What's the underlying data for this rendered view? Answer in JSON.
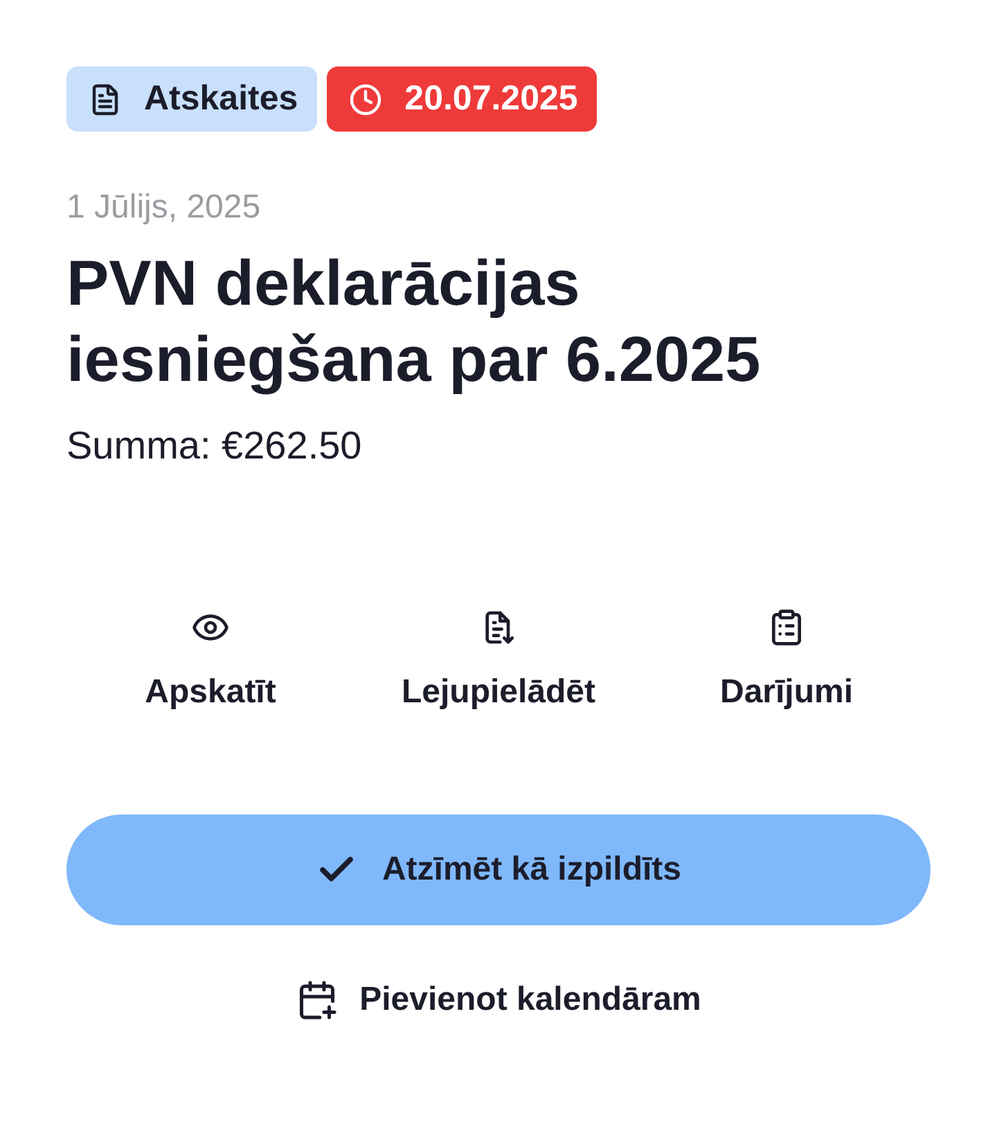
{
  "tags": [
    {
      "kind": "category",
      "label": "Atskaites"
    },
    {
      "kind": "deadline",
      "label": "20.07.2025"
    }
  ],
  "date": "1 Jūlijs, 2025",
  "title": "PVN deklarācijas iesniegšana par 6.2025",
  "amount": "Summa: €262.50",
  "actions": [
    {
      "kind": "view",
      "label": "Apskatīt"
    },
    {
      "kind": "download",
      "label": "Lejupielādēt"
    },
    {
      "kind": "transactions",
      "label": "Darījumi"
    }
  ],
  "primary_button": {
    "label": "Atzīmēt kā izpildīts"
  },
  "calendar_link": {
    "label": "Pievienot kalendāram"
  }
}
